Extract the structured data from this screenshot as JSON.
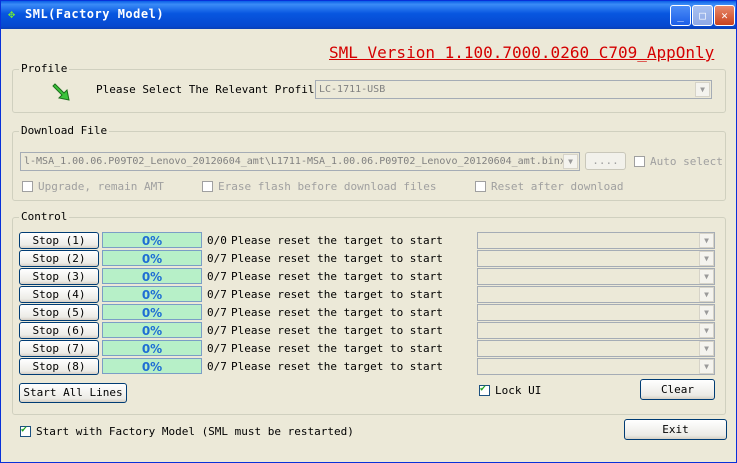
{
  "window": {
    "title": "SML(Factory Model)",
    "controls": {
      "minimize": "_",
      "maximize": "□",
      "close": "✕"
    }
  },
  "version_text": "SML Version 1.100.7000.0260 C709_AppOnly",
  "profile": {
    "legend": "Profile",
    "prompt": "Please Select The Relevant Profile",
    "selected": "LC-1711-USB",
    "icon": "arrow-icon"
  },
  "download": {
    "legend": "Download File",
    "file_path": "l-MSA_1.00.06.P09T02_Lenovo_20120604_amt\\L1711-MSA_1.00.06.P09T02_Lenovo_20120604_amt.binx",
    "browse_label": "....",
    "auto_select_label": "Auto select",
    "upgrade_label": "Upgrade, remain AMT",
    "erase_label": "Erase flash before download files",
    "reset_label": "Reset after download"
  },
  "control": {
    "legend": "Control",
    "lines": [
      {
        "button": "Stop (1)",
        "progress": "0%",
        "count": "0/0",
        "status": "Please reset the target to start"
      },
      {
        "button": "Stop (2)",
        "progress": "0%",
        "count": "0/7",
        "status": "Please reset the target to start"
      },
      {
        "button": "Stop (3)",
        "progress": "0%",
        "count": "0/7",
        "status": "Please reset the target to start"
      },
      {
        "button": "Stop (4)",
        "progress": "0%",
        "count": "0/7",
        "status": "Please reset the target to start"
      },
      {
        "button": "Stop (5)",
        "progress": "0%",
        "count": "0/7",
        "status": "Please reset the target to start"
      },
      {
        "button": "Stop (6)",
        "progress": "0%",
        "count": "0/7",
        "status": "Please reset the target to start"
      },
      {
        "button": "Stop (7)",
        "progress": "0%",
        "count": "0/7",
        "status": "Please reset the target to start"
      },
      {
        "button": "Stop (8)",
        "progress": "0%",
        "count": "0/7",
        "status": "Please reset the target to start"
      }
    ],
    "start_all_label": "Start All Lines",
    "lock_ui_label": "Lock UI",
    "clear_label": "Clear"
  },
  "footer": {
    "factory_model_label": "Start with Factory Model (SML must be restarted)",
    "exit_label": "Exit"
  },
  "colors": {
    "version_red": "#d40000",
    "progress_fill": "#b7f0c8",
    "progress_text": "#1e6ed4"
  }
}
